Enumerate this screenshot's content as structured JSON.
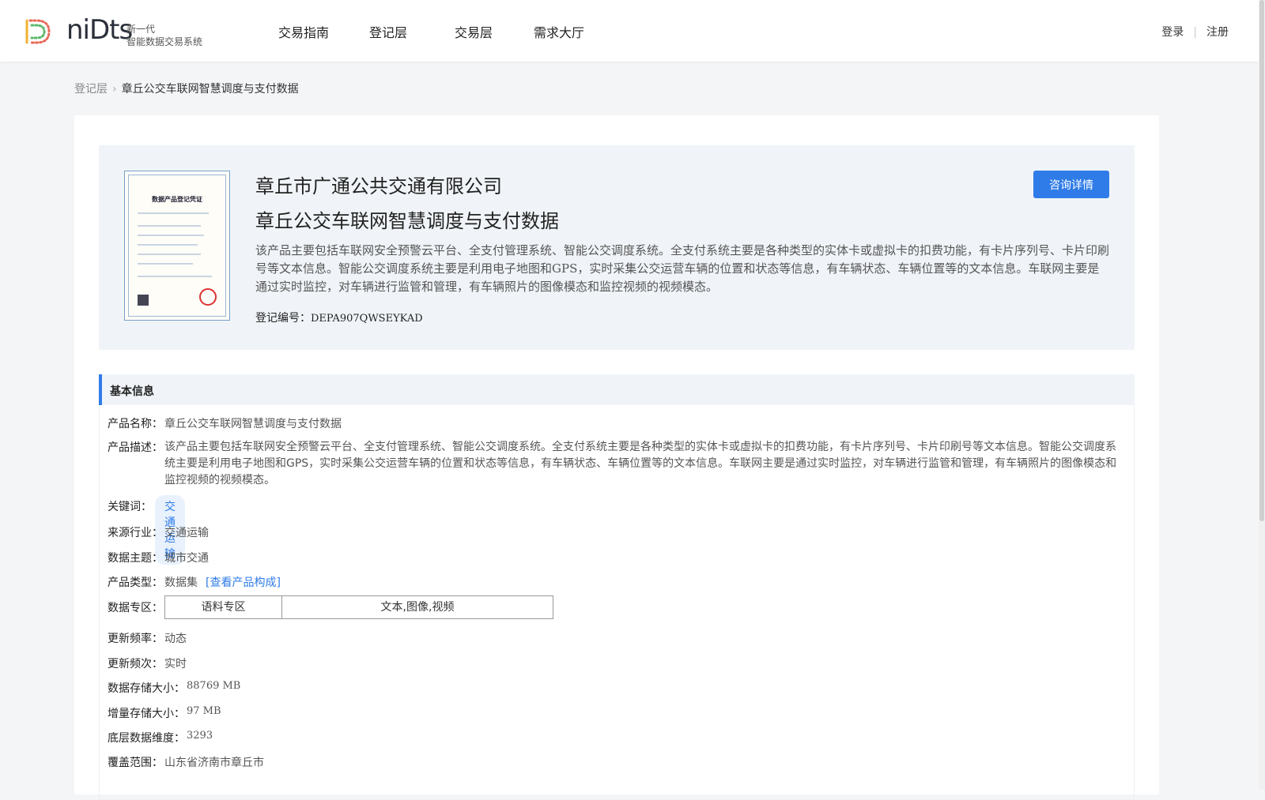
{
  "header": {
    "logo_word": "niDts",
    "logo_sub1": "新一代",
    "logo_sub2": "智能数据交易系统",
    "nav": [
      "交易指南",
      "登记层",
      "交易层",
      "需求大厅"
    ],
    "login": "登录",
    "register": "注册"
  },
  "breadcrumb": {
    "parent": "登记层",
    "separator": ">",
    "current": "章丘公交车联网智慧调度与支付数据"
  },
  "hero": {
    "company": "章丘市广通公共交通有限公司",
    "product_title": "章丘公交车联网智慧调度与支付数据",
    "description": "该产品主要包括车联网安全预警云平台、全支付管理系统、智能公交调度系统。全支付系统主要是各种类型的实体卡或虚拟卡的扣费功能，有卡片序列号、卡片印刷号等文本信息。智能公交调度系统主要是利用电子地图和GPS，实时采集公交运营车辆的位置和状态等信息，有车辆状态、车辆位置等的文本信息。车联网主要是通过实时监控，对车辆进行监管和管理，有车辆照片的图像模态和监控视频的视频模态。",
    "reg_label": "登记编号：",
    "reg_value": "DEPA907QWSEYKAD",
    "consult_button": "咨询详情",
    "cert_title": "数据产品登记凭证"
  },
  "basic_info": {
    "section_title": "基本信息",
    "product_name_label": "产品名称：",
    "product_name": "章丘公交车联网智慧调度与支付数据",
    "desc_label": "产品描述：",
    "desc": "该产品主要包括车联网安全预警云平台、全支付管理系统、智能公交调度系统。全支付系统主要是各种类型的实体卡或虚拟卡的扣费功能，有卡片序列号、卡片印刷号等文本信息。智能公交调度系统主要是利用电子地图和GPS，实时采集公交运营车辆的位置和状态等信息，有车辆状态、车辆位置等的文本信息。车联网主要是通过实时监控，对车辆进行监管和管理，有车辆照片的图像模态和监控视频的视频模态。",
    "keyword_label": "关键词：",
    "keyword": "交通运输",
    "industry_label": "来源行业：",
    "industry": "交通运输",
    "theme_label": "数据主题：",
    "theme": "城市交通",
    "type_label": "产品类型：",
    "type": "数据集",
    "type_link": "[查看产品构成]",
    "zone_label": "数据专区：",
    "zone_name": "语料专区",
    "zone_value": "文本,图像,视频",
    "freq_label": "更新频率：",
    "freq": "动态",
    "times_label": "更新频次：",
    "times": "实时",
    "storage_label": "数据存储大小：",
    "storage": "88769 MB",
    "inc_label": "增量存储大小：",
    "inc": "97 MB",
    "dim_label": "底层数据维度：",
    "dim": "3293",
    "coverage_label": "覆盖范围：",
    "coverage": "山东省济南市章丘市"
  },
  "colors": {
    "accent": "#2f7ce8",
    "hero_bg": "#f0f4f8",
    "page_bg": "#f4f5f7"
  }
}
